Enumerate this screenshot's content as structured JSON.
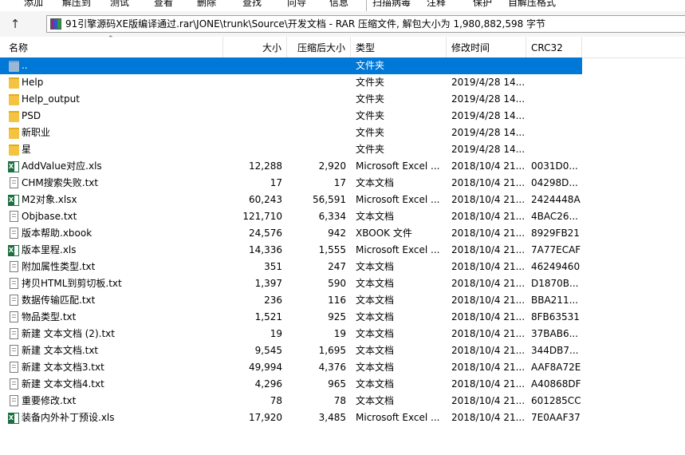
{
  "toolbar": {
    "buttons": [
      "添加",
      "解压到",
      "测试",
      "查看",
      "删除",
      "查找",
      "向导",
      "信息",
      "扫描病毒",
      "注释",
      "保护",
      "自解压格式"
    ]
  },
  "address": {
    "path": "91引擎源码XE版编译通过.rar\\JONE\\trunk\\Source\\开发文档 - RAR 压缩文件, 解包大小为 1,980,882,598 字节"
  },
  "columns": {
    "name": "名称",
    "size": "大小",
    "packed": "压缩后大小",
    "type": "类型",
    "modified": "修改时间",
    "crc": "CRC32"
  },
  "files": [
    {
      "icon": "parent-folder",
      "name": "..",
      "size": "",
      "packed": "",
      "type": "文件夹",
      "modified": "",
      "crc": "",
      "selected": true
    },
    {
      "icon": "folder",
      "name": "Help",
      "size": "",
      "packed": "",
      "type": "文件夹",
      "modified": "2019/4/28 14...",
      "crc": ""
    },
    {
      "icon": "folder",
      "name": "Help_output",
      "size": "",
      "packed": "",
      "type": "文件夹",
      "modified": "2019/4/28 14...",
      "crc": ""
    },
    {
      "icon": "folder",
      "name": "PSD",
      "size": "",
      "packed": "",
      "type": "文件夹",
      "modified": "2019/4/28 14...",
      "crc": ""
    },
    {
      "icon": "folder",
      "name": "新职业",
      "size": "",
      "packed": "",
      "type": "文件夹",
      "modified": "2019/4/28 14...",
      "crc": ""
    },
    {
      "icon": "folder",
      "name": "星",
      "size": "",
      "packed": "",
      "type": "文件夹",
      "modified": "2019/4/28 14...",
      "crc": ""
    },
    {
      "icon": "excel",
      "name": "AddValue对应.xls",
      "size": "12,288",
      "packed": "2,920",
      "type": "Microsoft Excel ...",
      "modified": "2018/10/4 21...",
      "crc": "0031D0..."
    },
    {
      "icon": "text",
      "name": "CHM搜索失败.txt",
      "size": "17",
      "packed": "17",
      "type": "文本文档",
      "modified": "2018/10/4 21...",
      "crc": "04298D..."
    },
    {
      "icon": "excel",
      "name": "M2对象.xlsx",
      "size": "60,243",
      "packed": "56,591",
      "type": "Microsoft Excel ...",
      "modified": "2018/10/4 21...",
      "crc": "2424448A"
    },
    {
      "icon": "text",
      "name": "Objbase.txt",
      "size": "121,710",
      "packed": "6,334",
      "type": "文本文档",
      "modified": "2018/10/4 21...",
      "crc": "4BAC26..."
    },
    {
      "icon": "file",
      "name": "版本帮助.xbook",
      "size": "24,576",
      "packed": "942",
      "type": "XBOOK 文件",
      "modified": "2018/10/4 21...",
      "crc": "8929FB21"
    },
    {
      "icon": "excel",
      "name": "版本里程.xls",
      "size": "14,336",
      "packed": "1,555",
      "type": "Microsoft Excel ...",
      "modified": "2018/10/4 21...",
      "crc": "7A77ECAF"
    },
    {
      "icon": "text",
      "name": "附加属性类型.txt",
      "size": "351",
      "packed": "247",
      "type": "文本文档",
      "modified": "2018/10/4 21...",
      "crc": "46249460"
    },
    {
      "icon": "text",
      "name": "拷贝HTML到剪切板.txt",
      "size": "1,397",
      "packed": "590",
      "type": "文本文档",
      "modified": "2018/10/4 21...",
      "crc": "D1870B..."
    },
    {
      "icon": "text",
      "name": "数据传输匹配.txt",
      "size": "236",
      "packed": "116",
      "type": "文本文档",
      "modified": "2018/10/4 21...",
      "crc": "BBA211..."
    },
    {
      "icon": "text",
      "name": "物品类型.txt",
      "size": "1,521",
      "packed": "925",
      "type": "文本文档",
      "modified": "2018/10/4 21...",
      "crc": "8FB63531"
    },
    {
      "icon": "text",
      "name": "新建 文本文档 (2).txt",
      "size": "19",
      "packed": "19",
      "type": "文本文档",
      "modified": "2018/10/4 21...",
      "crc": "37BAB6..."
    },
    {
      "icon": "text",
      "name": "新建 文本文档.txt",
      "size": "9,545",
      "packed": "1,695",
      "type": "文本文档",
      "modified": "2018/10/4 21...",
      "crc": "344DB7..."
    },
    {
      "icon": "text",
      "name": "新建 文本文档3.txt",
      "size": "49,994",
      "packed": "4,376",
      "type": "文本文档",
      "modified": "2018/10/4 21...",
      "crc": "AAF8A72E"
    },
    {
      "icon": "text",
      "name": "新建 文本文档4.txt",
      "size": "4,296",
      "packed": "965",
      "type": "文本文档",
      "modified": "2018/10/4 21...",
      "crc": "A40868DF"
    },
    {
      "icon": "text",
      "name": "重要修改.txt",
      "size": "78",
      "packed": "78",
      "type": "文本文档",
      "modified": "2018/10/4 21...",
      "crc": "601285CC"
    },
    {
      "icon": "excel",
      "name": "装备内外补丁预设.xls",
      "size": "17,920",
      "packed": "3,485",
      "type": "Microsoft Excel ...",
      "modified": "2018/10/4 21...",
      "crc": "7E0AAF37"
    }
  ],
  "colors": {
    "selection": "#0078d7",
    "folder": "#f5c342",
    "excel": "#1d6f42"
  }
}
